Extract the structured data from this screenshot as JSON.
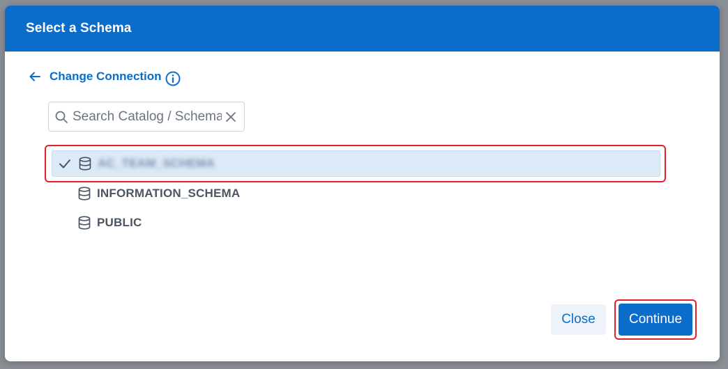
{
  "dialog": {
    "title": "Select a Schema"
  },
  "back_link": {
    "label": "Change Connection",
    "icon": "arrow-left-icon",
    "info_icon": "info-icon"
  },
  "search": {
    "placeholder": "Search Catalog / Schema",
    "value": "",
    "icon": "search-icon",
    "clear_icon": "close-icon"
  },
  "schemas": [
    {
      "label": "AC_TEAM_SCHEMA",
      "selected": true,
      "obscured": true,
      "icon": "database-icon"
    },
    {
      "label": "INFORMATION_SCHEMA",
      "selected": false,
      "icon": "database-icon"
    },
    {
      "label": "PUBLIC",
      "selected": false,
      "icon": "database-icon"
    }
  ],
  "footer": {
    "close_label": "Close",
    "continue_label": "Continue"
  },
  "colors": {
    "primary": "#0b6cc9",
    "selected_row": "#dce9f6",
    "annotation": "#e41f2a",
    "text": "#4b5563"
  }
}
